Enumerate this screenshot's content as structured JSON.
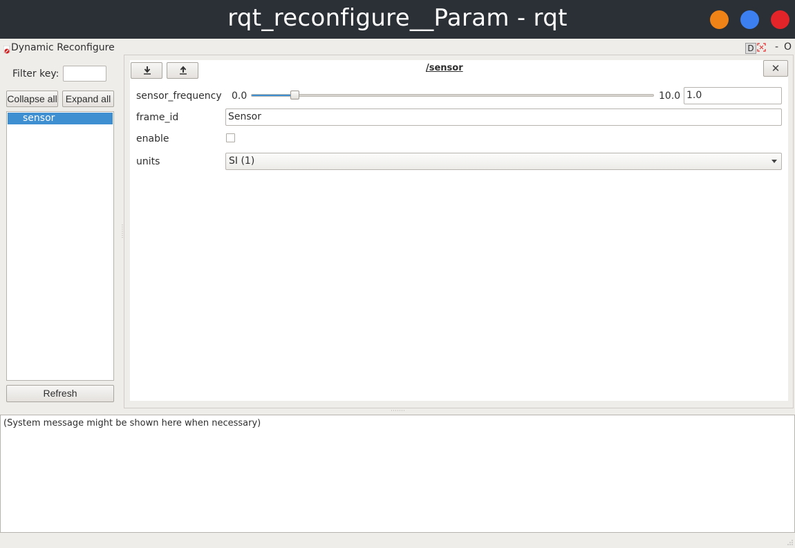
{
  "window": {
    "title": "rqt_reconfigure__Param - rqt",
    "controls": {
      "minimize_color": "#f08317",
      "maximize_color": "#3b7ff0",
      "close_color": "#e32529"
    }
  },
  "plugin": {
    "title": "Dynamic Reconfigure",
    "icon": "dynamic-reconfigure-icon",
    "dock_buttons": {
      "d_label": "D",
      "minimize_label": "-",
      "close_label": "O"
    }
  },
  "sidebar": {
    "filter_label": "Filter key:",
    "filter_value": "",
    "collapse_all_label": "Collapse all",
    "expand_all_label": "Expand all",
    "tree_items": [
      {
        "label": "sensor",
        "selected": true
      }
    ],
    "refresh_label": "Refresh"
  },
  "node_panel": {
    "title": "/sensor",
    "download_icon": "download-icon",
    "upload_icon": "upload-icon",
    "close_label": "✕",
    "params": {
      "sensor_frequency": {
        "label": "sensor_frequency",
        "min_label": "0.0",
        "max_label": "10.0",
        "min": 0.0,
        "max": 10.0,
        "value": 1.0,
        "value_text": "1.0"
      },
      "frame_id": {
        "label": "frame_id",
        "value": "Sensor"
      },
      "enable": {
        "label": "enable",
        "checked": false
      },
      "units": {
        "label": "units",
        "selected": "SI (1)"
      }
    }
  },
  "message_area": {
    "text": "(System message might be shown here when necessary)"
  },
  "colors": {
    "accent": "#3d8fd2",
    "titlebar": "#2b2f36",
    "background": "#efedea"
  }
}
